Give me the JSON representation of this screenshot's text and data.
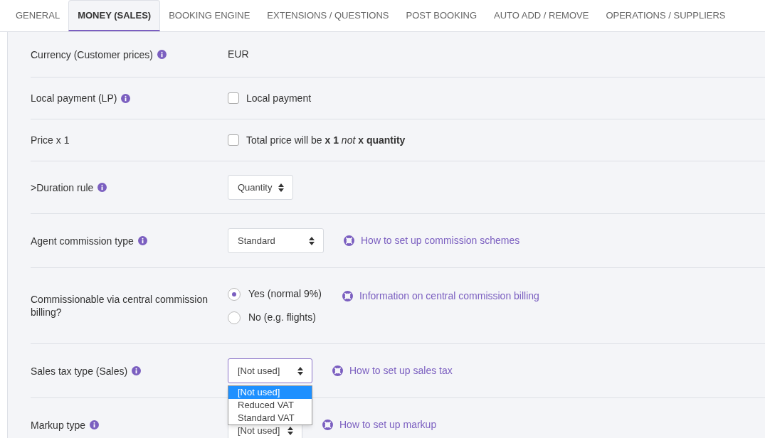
{
  "tabs": [
    {
      "label": "GENERAL",
      "selected": false
    },
    {
      "label": "MONEY (SALES)",
      "selected": true
    },
    {
      "label": "BOOKING ENGINE",
      "selected": false
    },
    {
      "label": "EXTENSIONS / QUESTIONS",
      "selected": false
    },
    {
      "label": "POST BOOKING",
      "selected": false
    },
    {
      "label": "AUTO ADD / REMOVE",
      "selected": false
    },
    {
      "label": "OPERATIONS / SUPPLIERS",
      "selected": false
    }
  ],
  "rows": [
    {
      "label": "Currency (Customer prices)",
      "info": true,
      "kind": "text",
      "value": "EUR"
    },
    {
      "label": "Local payment (LP)",
      "info": true,
      "kind": "checkbox",
      "checked": false,
      "text": "Local payment"
    },
    {
      "label": "Price x 1",
      "info": false,
      "kind": "checkbox",
      "checked": false,
      "text": "Total price will be **x 1** *not* **x quantity**"
    },
    {
      "label": ">Duration rule",
      "info": true,
      "kind": "select",
      "value": "Quantity",
      "focused": false
    },
    {
      "label": "Agent commission type",
      "info": true,
      "kind": "select",
      "value": "Standard",
      "focused": false,
      "help": "How to set up commission schemes"
    },
    {
      "label": "Commissionable via central commission billing?",
      "info": false,
      "kind": "radio",
      "options": [
        {
          "label": "Yes (normal 9%)",
          "selected": true
        },
        {
          "label": "No (e.g. flights)",
          "selected": false
        }
      ],
      "help": "Information on central commission billing"
    },
    {
      "label": "Sales tax type (Sales)",
      "info": true,
      "kind": "select",
      "value": "[Not used]",
      "focused": true,
      "help": "How to set up sales tax",
      "dropdown": [
        {
          "label": "[Not used]",
          "selected": true
        },
        {
          "label": "Reduced VAT",
          "selected": false
        },
        {
          "label": "Standard VAT",
          "selected": false
        }
      ]
    },
    {
      "label": "Markup type",
      "info": true,
      "kind": "select",
      "value": "[Not used]",
      "focused": false,
      "help": "How to set up markup"
    }
  ]
}
